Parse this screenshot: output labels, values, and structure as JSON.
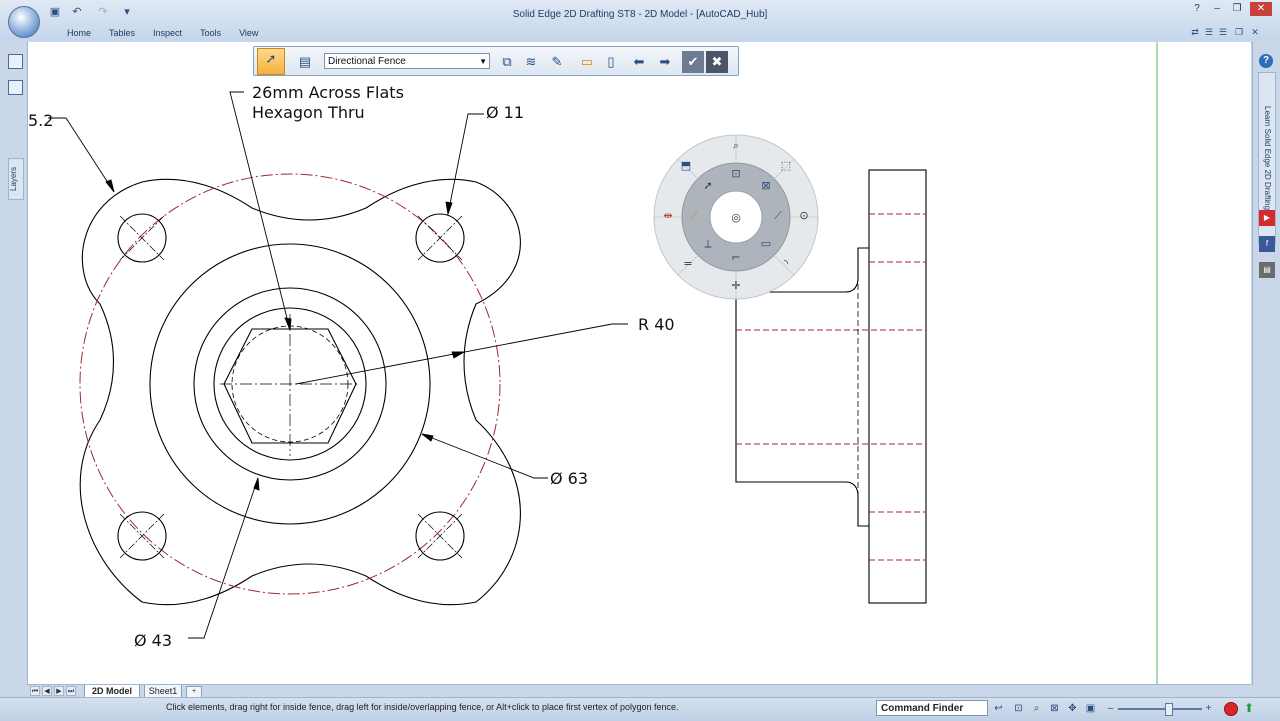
{
  "window": {
    "title": "Solid Edge 2D Drafting ST8 - 2D Model - [AutoCAD_Hub]",
    "controls": [
      "?",
      "–",
      "❐",
      "✕"
    ]
  },
  "ribbon": {
    "tabs": [
      {
        "label": "Home"
      },
      {
        "label": "Tables"
      },
      {
        "label": "Inspect"
      },
      {
        "label": "Tools"
      },
      {
        "label": "View"
      }
    ]
  },
  "left_dock": {
    "layers_label": "Layers"
  },
  "right_dock": {
    "learn_label": "Learn Solid Edge 2D Drafting",
    "help_glyph": "?"
  },
  "command_bar": {
    "fence_mode": "Directional Fence"
  },
  "drawing": {
    "annotations": {
      "hex_line1": "26mm Across Flats",
      "hex_line2": "Hexagon Thru",
      "hole_dia": "Ø 11",
      "radius": "R 40",
      "dia_63": "Ø 63",
      "dia_43": "Ø 43",
      "partial_left": "5.2"
    },
    "line_color": "#000000",
    "centerline_color": "#a02a2a"
  },
  "radial_menu": {
    "center_icon": "circle-select-icon",
    "items": [
      "zoom-icon",
      "zoom-area-icon",
      "fit-icon",
      "select-icon",
      "circle-icon",
      "line-icon",
      "dimension-icon",
      "smart-dim-icon",
      "fillet-icon",
      "arc-icon",
      "equal-icon",
      "crosshair-icon"
    ]
  },
  "sheet_tabs": {
    "active": "2D Model",
    "other": "Sheet1"
  },
  "status": {
    "prompt": "Click elements, drag right for inside fence, drag left for inside/overlapping fence, or Alt+click to place first vertex of polygon fence.",
    "command_finder": "Command Finder",
    "zoom_level": 0.6
  }
}
